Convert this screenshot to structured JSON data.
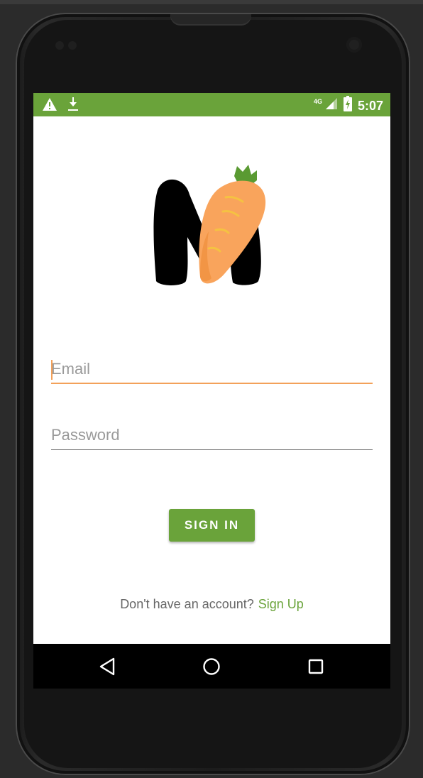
{
  "statusbar": {
    "time": "5:07",
    "network": "4G",
    "icons": [
      "warning-icon",
      "download-icon",
      "signal-icon",
      "battery-charging-icon"
    ]
  },
  "app": {
    "logo": "M"
  },
  "form": {
    "email_placeholder": "Email",
    "email_value": "",
    "password_placeholder": "Password",
    "password_value": ""
  },
  "actions": {
    "signin_label": "SIGN IN",
    "signup_question": "Don't have an account?",
    "signup_link": "Sign Up"
  },
  "navbar": {
    "icons": [
      "back-icon",
      "home-icon",
      "recents-icon"
    ]
  },
  "colors": {
    "primary": "#6aa33a",
    "accent": "#f3a15a",
    "carrot": "#f9a45c",
    "carrot_leaves": "#5a9a32"
  }
}
